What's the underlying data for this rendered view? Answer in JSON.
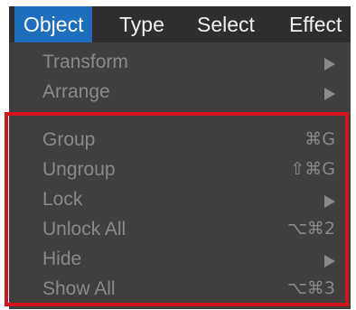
{
  "menubar": {
    "items": [
      {
        "label": "Object",
        "active": true
      },
      {
        "label": "Type"
      },
      {
        "label": "Select"
      },
      {
        "label": "Effect"
      }
    ]
  },
  "dropdown": {
    "items": [
      {
        "label": "Transform",
        "submenu": true,
        "shortcut": "",
        "icon": "submenu-arrow-icon"
      },
      {
        "label": "Arrange",
        "submenu": true,
        "shortcut": "",
        "icon": "submenu-arrow-icon"
      },
      {
        "label": "Group",
        "submenu": false,
        "shortcut": "⌘G"
      },
      {
        "label": "Ungroup",
        "submenu": false,
        "shortcut": "⇧⌘G"
      },
      {
        "label": "Lock",
        "submenu": true,
        "shortcut": "",
        "icon": "submenu-arrow-icon"
      },
      {
        "label": "Unlock All",
        "submenu": false,
        "shortcut": "⌥⌘2"
      },
      {
        "label": "Hide",
        "submenu": true,
        "shortcut": "",
        "icon": "submenu-arrow-icon"
      },
      {
        "label": "Show All",
        "submenu": false,
        "shortcut": "⌥⌘3"
      }
    ]
  },
  "colors": {
    "menubar_bg": "#2e2e2e",
    "active_bg": "#1f6dbd",
    "menu_bg": "#3f3f3f",
    "disabled_text": "#8a8a8a",
    "highlight_border": "#d4131e"
  }
}
